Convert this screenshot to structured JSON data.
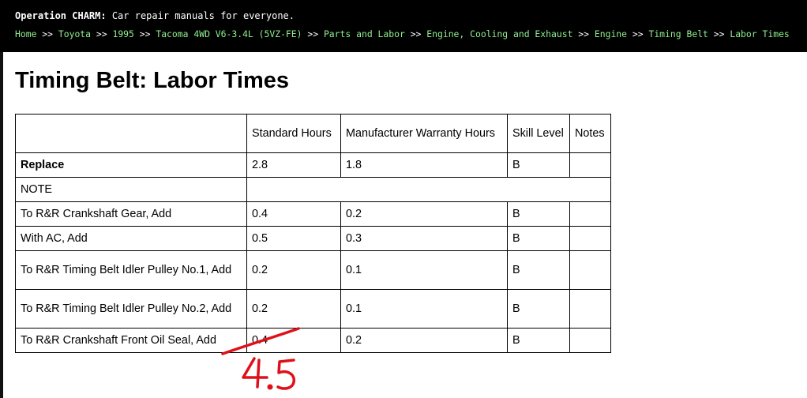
{
  "header": {
    "site_name": "Operation CHARM:",
    "tagline": " Car repair manuals for everyone.",
    "breadcrumb": [
      "Home",
      "Toyota",
      "1995",
      "Tacoma 4WD V6-3.4L (5VZ-FE)",
      "Parts and Labor",
      "Engine, Cooling and Exhaust",
      "Engine",
      "Timing Belt",
      "Labor Times"
    ],
    "separator": ">>"
  },
  "page_title": "Timing Belt: Labor Times",
  "table": {
    "headers": [
      "",
      "Standard Hours",
      "Manufacturer Warranty Hours",
      "Skill Level",
      "Notes"
    ],
    "rows": [
      {
        "label": "Replace",
        "std": "2.8",
        "mfr": "1.8",
        "skill": "B",
        "notes": ""
      },
      {
        "label": "NOTE",
        "std": "",
        "mfr": "",
        "skill": "",
        "notes": ""
      },
      {
        "label": "To R&R Crankshaft Gear, Add",
        "std": "0.4",
        "mfr": "0.2",
        "skill": "B",
        "notes": ""
      },
      {
        "label": "With AC, Add",
        "std": "0.5",
        "mfr": "0.3",
        "skill": "B",
        "notes": ""
      },
      {
        "label": "To R&R Timing Belt Idler Pulley No.1, Add",
        "std": "0.2",
        "mfr": "0.1",
        "skill": "B",
        "notes": ""
      },
      {
        "label": "To R&R Timing Belt Idler Pulley No.2, Add",
        "std": "0.2",
        "mfr": "0.1",
        "skill": "B",
        "notes": ""
      },
      {
        "label": "To R&R Crankshaft Front Oil Seal, Add",
        "std": "0.4",
        "mfr": "0.2",
        "skill": "B",
        "notes": ""
      }
    ]
  },
  "annotation": {
    "handwritten_total": "4.5",
    "color": "#e0101a"
  },
  "colors": {
    "header_bg": "#000000",
    "link": "#8ff08f"
  }
}
